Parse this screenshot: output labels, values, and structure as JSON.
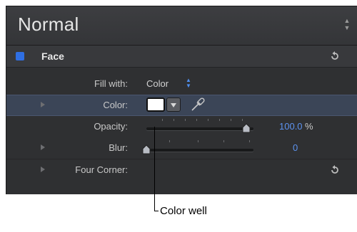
{
  "preset": {
    "label": "Normal",
    "stepper_icon": "up-down-stepper-icon"
  },
  "section": {
    "title": "Face",
    "enabled": true,
    "reset_icon": "reset-arrow-icon"
  },
  "rows": {
    "fill_with": {
      "label": "Fill with:",
      "value": "Color"
    },
    "color": {
      "label": "Color:",
      "swatch_color": "#ffffff",
      "eyedropper_icon": "eyedropper-icon"
    },
    "opacity": {
      "label": "Opacity:",
      "value": "100.0",
      "unit": "%",
      "level": 1.0
    },
    "blur": {
      "label": "Blur:",
      "value": "0",
      "level": 0.0
    },
    "four_corner": {
      "label": "Four Corner:",
      "reset_icon": "reset-arrow-icon"
    }
  },
  "callout": {
    "text": "Color well"
  },
  "colors": {
    "accent": "#5d93f0",
    "checkbox": "#2f6fe3",
    "selected_row": "#3b4557"
  }
}
